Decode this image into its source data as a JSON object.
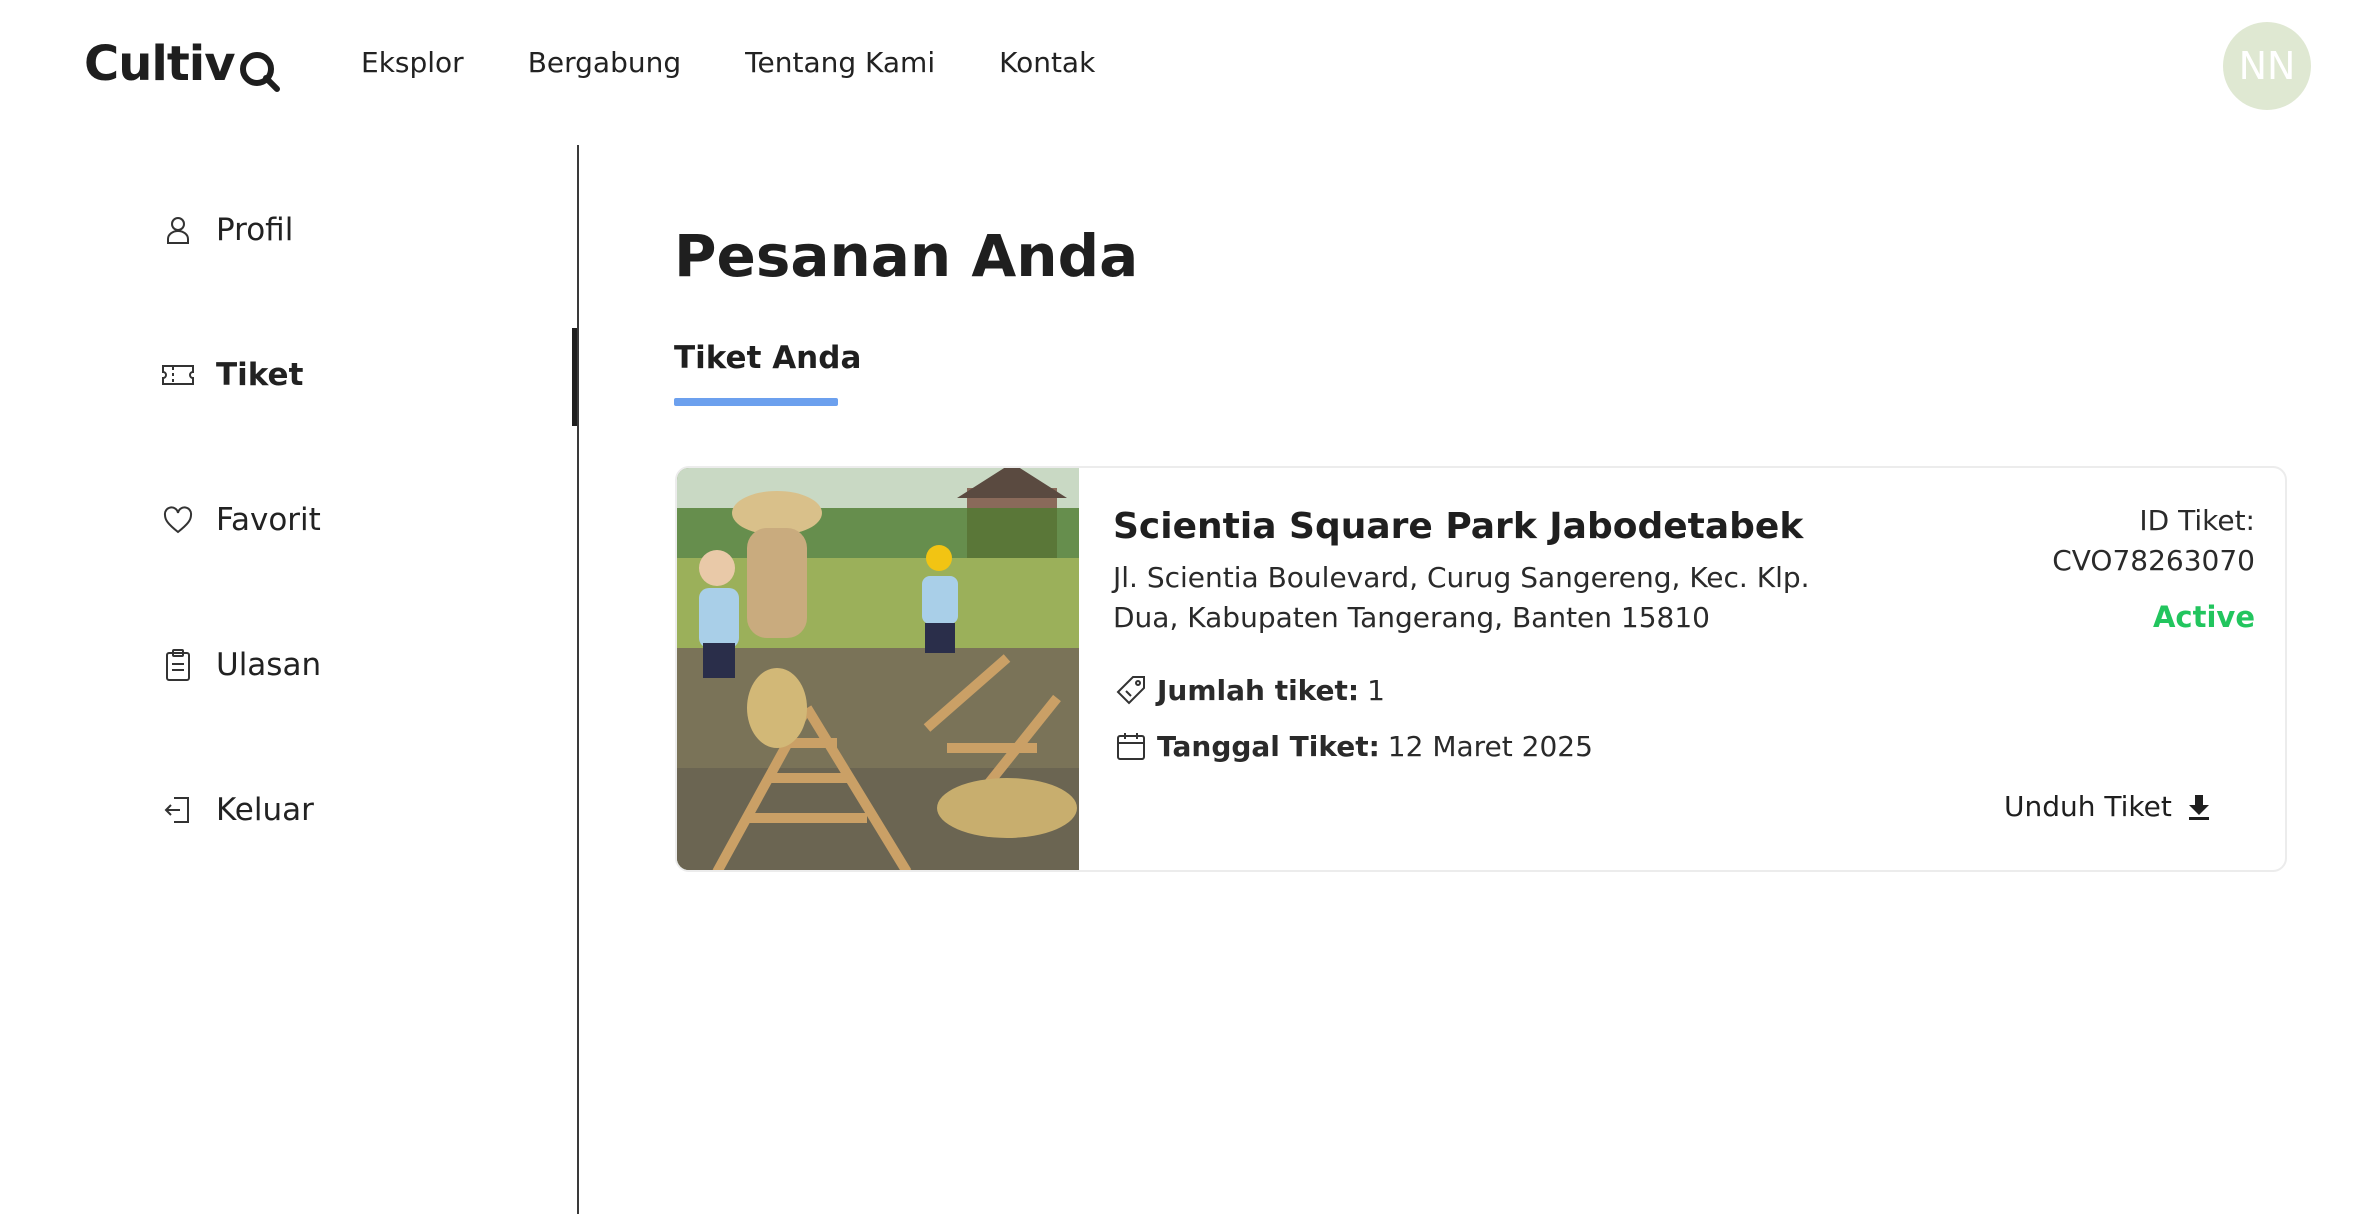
{
  "brand": {
    "logo_text": "Cultiv",
    "logo_accent": "#e8c840"
  },
  "nav": {
    "items": [
      {
        "label": "Eksplor"
      },
      {
        "label": "Bergabung"
      },
      {
        "label": "Tentang Kami"
      },
      {
        "label": "Kontak"
      }
    ]
  },
  "user": {
    "initials": "NN",
    "avatar_color": "#dfe8d2"
  },
  "sidebar": {
    "items": [
      {
        "label": "Profil",
        "icon": "person-icon"
      },
      {
        "label": "Tiket",
        "icon": "ticket-icon",
        "active": true
      },
      {
        "label": "Favorit",
        "icon": "heart-icon"
      },
      {
        "label": "Ulasan",
        "icon": "clipboard-icon"
      },
      {
        "label": "Keluar",
        "icon": "logout-icon"
      }
    ]
  },
  "main": {
    "title": "Pesanan Anda",
    "tabs": [
      {
        "label": "Tiket Anda",
        "active": true
      }
    ],
    "tab_accent": "#6ca0ee"
  },
  "ticket": {
    "name": "Scientia Square Park Jabodetabek",
    "address": "Jl. Scientia Boulevard, Curug Sangereng, Kec. Klp. Dua, Kabupaten Tangerang, Banten 15810",
    "quantity_label": "Jumlah tiket:",
    "quantity_value": "1",
    "date_label": "Tanggal Tiket:",
    "date_value": "12 Maret 2025",
    "id_label": "ID Tiket:",
    "id_value": "CVO78263070",
    "status": "Active",
    "status_color": "#22c55e",
    "download_label": "Unduh Tiket"
  }
}
